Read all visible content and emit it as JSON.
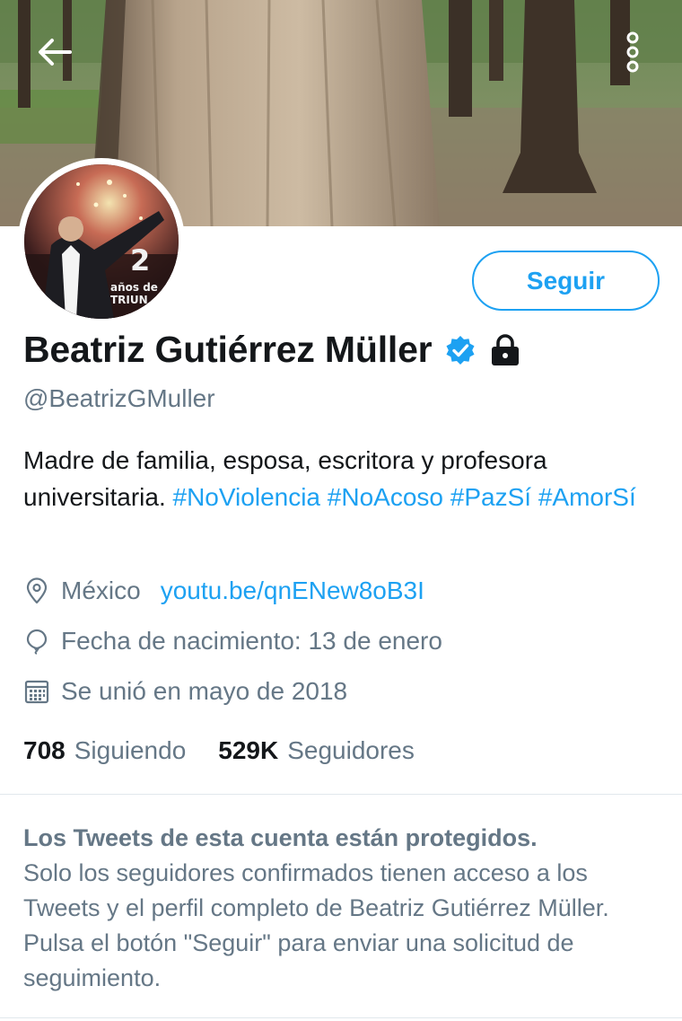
{
  "header": {
    "back_icon": "arrow-left-icon",
    "more_icon": "more-vertical-icon"
  },
  "avatar": {
    "badge_number": "2",
    "caption": "años de\nTRIUN"
  },
  "profile": {
    "follow_label": "Seguir",
    "name": "Beatriz Gutiérrez Müller",
    "verified_icon": "verified-badge-icon",
    "protected_icon": "lock-icon",
    "handle": "@BeatrizGMuller",
    "bio_text": "Madre de familia, esposa, escritora y profesora universitaria. ",
    "bio_hashtags": [
      "#NoViolencia",
      "#NoAcoso",
      "#PazSí",
      "#AmorSí"
    ],
    "location": "México",
    "website": "youtu.be/qnENew8oB3I",
    "birthday": "Fecha de nacimiento: 13 de enero",
    "joined": "Se unió en mayo de 2018"
  },
  "stats": {
    "following_count": "708",
    "following_label": "Siguiendo",
    "followers_count": "529K",
    "followers_label": "Seguidores"
  },
  "protected_notice": {
    "title": "Los Tweets de esta cuenta están protegidos.",
    "body": "Solo los seguidores confirmados tienen acceso a los Tweets y el perfil completo de Beatriz Gutiérrez Müller. Pulsa el botón \"Seguir\" para enviar una solicitud de seguimiento."
  },
  "colors": {
    "accent": "#1da1f2",
    "text_primary": "#14171a",
    "text_secondary": "#657786",
    "divider": "#e1e8ed"
  }
}
